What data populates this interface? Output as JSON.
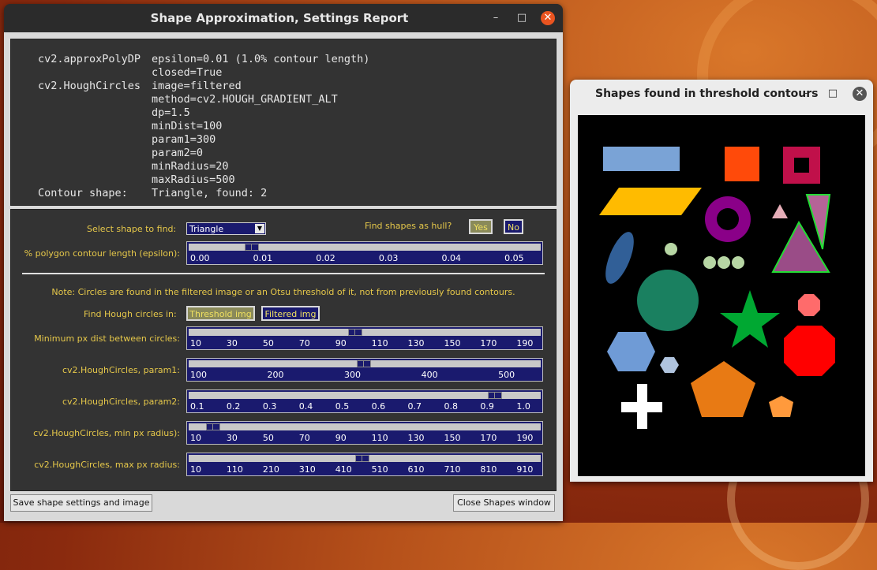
{
  "main_window": {
    "title": "Shape Approximation, Settings Report",
    "minimize": "–",
    "maximize": "□",
    "close": "✕"
  },
  "report": {
    "lines": [
      {
        "key": "cv2.approxPolyDP",
        "value": "epsilon=0.01 (1.0% contour length)"
      },
      {
        "key": "",
        "value": "closed=True"
      },
      {
        "key": "cv2.HoughCircles",
        "value": "image=filtered"
      },
      {
        "key": "",
        "value": "method=cv2.HOUGH_GRADIENT_ALT"
      },
      {
        "key": "",
        "value": "dp=1.5"
      },
      {
        "key": "",
        "value": "minDist=100"
      },
      {
        "key": "",
        "value": "param1=300"
      },
      {
        "key": "",
        "value": "param2=0"
      },
      {
        "key": "",
        "value": "minRadius=20"
      },
      {
        "key": "",
        "value": "maxRadius=500"
      },
      {
        "key": "Contour shape:",
        "value": "Triangle, found: 2"
      }
    ]
  },
  "controls": {
    "select_label": "Select shape to find:",
    "select_value": "Triangle",
    "hull_label": "Find shapes as hull?",
    "hull_yes": "Yes",
    "hull_no": "No",
    "note": "Note: Circles are found in the filtered image or an Otsu threshold of it, not from previously found contours.",
    "hough_in_label": "Find Hough circles in:",
    "hough_threshold": "Threshold img",
    "hough_filtered": "Filtered img",
    "colors": {
      "label": "#e6c84a",
      "slider_bg": "#1a1a6e",
      "accent_close": "#e95420"
    }
  },
  "sliders": [
    {
      "label": "% polygon contour length (epsilon):",
      "ticks": [
        "0.00",
        "0.01",
        "0.02",
        "0.03",
        "0.04",
        "0.05"
      ],
      "min": 0,
      "max": 0.06,
      "value": 0.01
    },
    {
      "label": "Minimum px dist between circles:",
      "ticks": [
        "10",
        "30",
        "50",
        "70",
        "90",
        "110",
        "130",
        "150",
        "170",
        "190"
      ],
      "min": 10,
      "max": 200,
      "value": 100
    },
    {
      "label": "cv2.HoughCircles, param1:",
      "ticks": [
        "100",
        "200",
        "300",
        "400",
        "500"
      ],
      "min": 100,
      "max": 500,
      "value": 300
    },
    {
      "label": "cv2.HoughCircles, param2:",
      "ticks": [
        "0.1",
        "0.2",
        "0.3",
        "0.4",
        "0.5",
        "0.6",
        "0.7",
        "0.8",
        "0.9",
        "1.0"
      ],
      "min": 0.1,
      "max": 1.0,
      "value": 0.9
    },
    {
      "label": "cv2.HoughCircles, min px radius):",
      "ticks": [
        "10",
        "30",
        "50",
        "70",
        "90",
        "110",
        "130",
        "150",
        "170",
        "190"
      ],
      "min": 10,
      "max": 200,
      "value": 20
    },
    {
      "label": "cv2.HoughCircles, max px radius:",
      "ticks": [
        "10",
        "110",
        "210",
        "310",
        "410",
        "510",
        "610",
        "710",
        "810",
        "910"
      ],
      "min": 10,
      "max": 1000,
      "value": 500
    }
  ],
  "buttons": {
    "save": "Save shape settings and image",
    "close_shapes": "Close Shapes window"
  },
  "shapes_window": {
    "title": "Shapes found in threshold contours",
    "minimize": "–",
    "maximize": "□",
    "close": "✕"
  }
}
